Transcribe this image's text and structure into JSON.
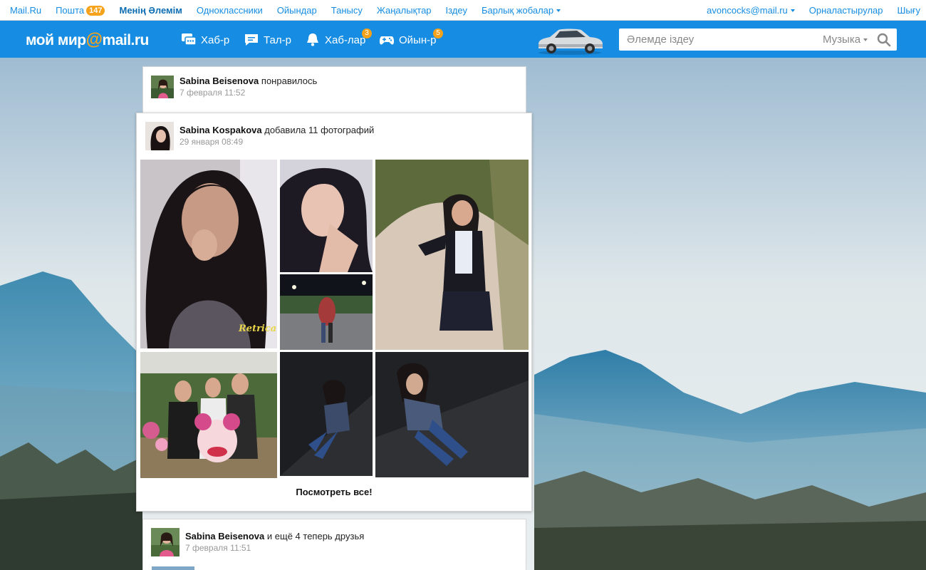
{
  "topbar": {
    "left": [
      {
        "label": "Mail.Ru"
      },
      {
        "label": "Пошта",
        "badge": "147"
      },
      {
        "label": "Менің Әлемім"
      },
      {
        "label": "Одноклассники"
      },
      {
        "label": "Ойындар"
      },
      {
        "label": "Танысу"
      },
      {
        "label": "Жаңалықтар"
      },
      {
        "label": "Іздеу"
      },
      {
        "label": "Барлық жобалар"
      }
    ],
    "user_email": "avoncocks@mail.ru",
    "settings": "Орналастырулар",
    "logout": "Шығу"
  },
  "header": {
    "logo_text": "мой мир",
    "logo_at": "@",
    "logo_domain": "mail.ru",
    "nav": [
      {
        "label": "Хаб-р",
        "icon": "messages-icon"
      },
      {
        "label": "Тал-р",
        "icon": "comment-icon"
      },
      {
        "label": "Хаб-лар",
        "icon": "bell-icon",
        "badge": "3"
      },
      {
        "label": "Ойын-р",
        "icon": "gamepad-icon",
        "badge": "5"
      }
    ],
    "search_placeholder": "Әлемде іздеу",
    "search_category": "Музыка"
  },
  "feed": [
    {
      "author": "Sabina Beisenova",
      "action": "понравилось",
      "date": "7 февраля 11:52"
    },
    {
      "author": "Sabina Kospakova",
      "action": "добавила 11 фотографий",
      "date": "29 января 08:49",
      "view_all": "Посмотреть все!",
      "photo_watermark": "Retrica"
    },
    {
      "author": "Sabina Beisenova",
      "action": "и ещё 4 теперь друзья",
      "date": "7 февраля 11:51"
    }
  ],
  "colors": {
    "brand_blue": "#168de2",
    "accent_orange": "#f7a21b",
    "link_blue": "#168de2"
  }
}
